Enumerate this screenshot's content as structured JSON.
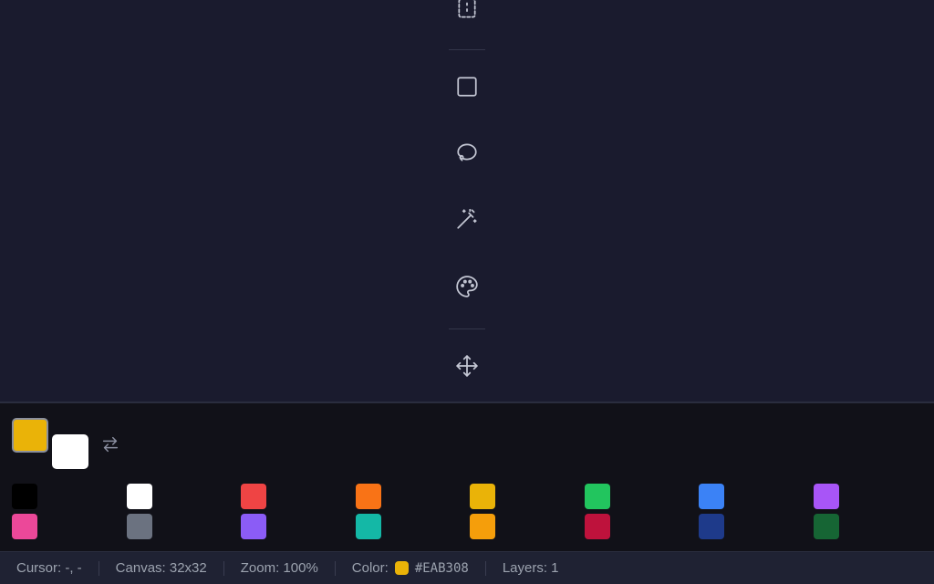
{
  "toolbar": {
    "tools": [
      {
        "name": "select",
        "icon": "dashed-rect-icon"
      },
      {
        "name": "rectangle",
        "icon": "square-icon"
      },
      {
        "name": "lasso",
        "icon": "lasso-icon"
      },
      {
        "name": "magic-wand",
        "icon": "magic-wand-icon"
      },
      {
        "name": "palette",
        "icon": "palette-icon"
      },
      {
        "name": "move",
        "icon": "move-icon"
      }
    ]
  },
  "colors": {
    "primary": "#EAB308",
    "secondary": "#FFFFFF",
    "swap_icon": "swap-icon",
    "palette_row1": [
      "#000000",
      "#FFFFFF",
      "#EF4444",
      "#F97316",
      "#EAB308",
      "#22C55E",
      "#3B82F6",
      "#A855F7"
    ],
    "palette_row2": [
      "#EC4899",
      "#6B7280",
      "#8B5CF6",
      "#14B8A6",
      "#F59E0B",
      "#BE123C",
      "#1E3A8A",
      "#166534"
    ]
  },
  "status": {
    "cursor": "Cursor: -, -",
    "canvas": "Canvas: 32x32",
    "zoom": "Zoom: 100%",
    "color_label": "Color:",
    "color_hex": "#EAB308",
    "layers": "Layers: 1"
  }
}
